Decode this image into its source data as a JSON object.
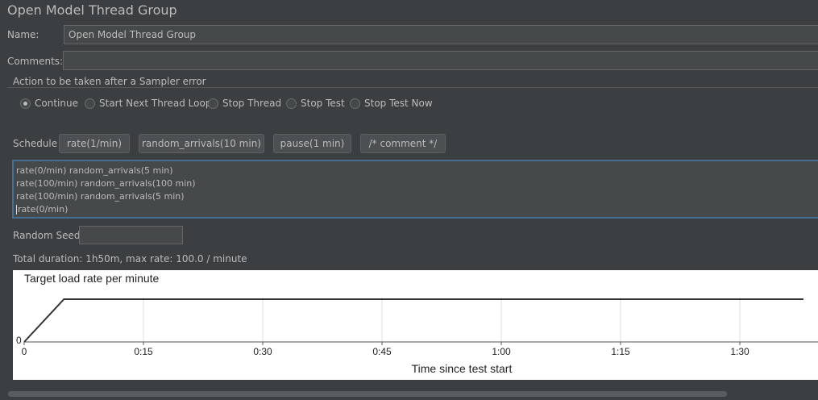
{
  "title": "Open Model Thread Group",
  "name_field": {
    "label": "Name:",
    "value": "Open Model Thread Group"
  },
  "comments_field": {
    "label": "Comments:",
    "value": ""
  },
  "error_action": {
    "legend": "Action to be taken after a Sampler error",
    "options": [
      "Continue",
      "Start Next Thread Loop",
      "Stop Thread",
      "Stop Test",
      "Stop Test Now"
    ],
    "selected": "Continue"
  },
  "schedule": {
    "label": "Schedule",
    "buttons": [
      "rate(1/min)",
      "random_arrivals(10 min)",
      "pause(1 min)",
      "/* comment */"
    ],
    "lines": [
      "rate(0/min) random_arrivals(5 min)",
      "rate(100/min) random_arrivals(100 min)",
      "rate(100/min) random_arrivals(5 min)",
      "rate(0/min)"
    ]
  },
  "random_seed": {
    "label": "Random Seed",
    "value": ""
  },
  "summary": "Total duration: 1h50m, max rate: 100.0 / minute",
  "chart_data": {
    "type": "line",
    "title": "Target load rate per minute",
    "xlabel": "Time since test start",
    "x_ticks": [
      "0",
      "0:15",
      "0:30",
      "0:45",
      "1:00",
      "1:15",
      "1:30"
    ],
    "y_ticks": [
      "0"
    ],
    "x_range_minutes": [
      0,
      98
    ],
    "grid": true,
    "series": [
      {
        "x": [
          0,
          5,
          98
        ],
        "y": [
          0,
          100,
          100
        ]
      }
    ],
    "colors": {
      "line": "#333333",
      "grid": "#dddddd",
      "axis": "#555555"
    }
  }
}
